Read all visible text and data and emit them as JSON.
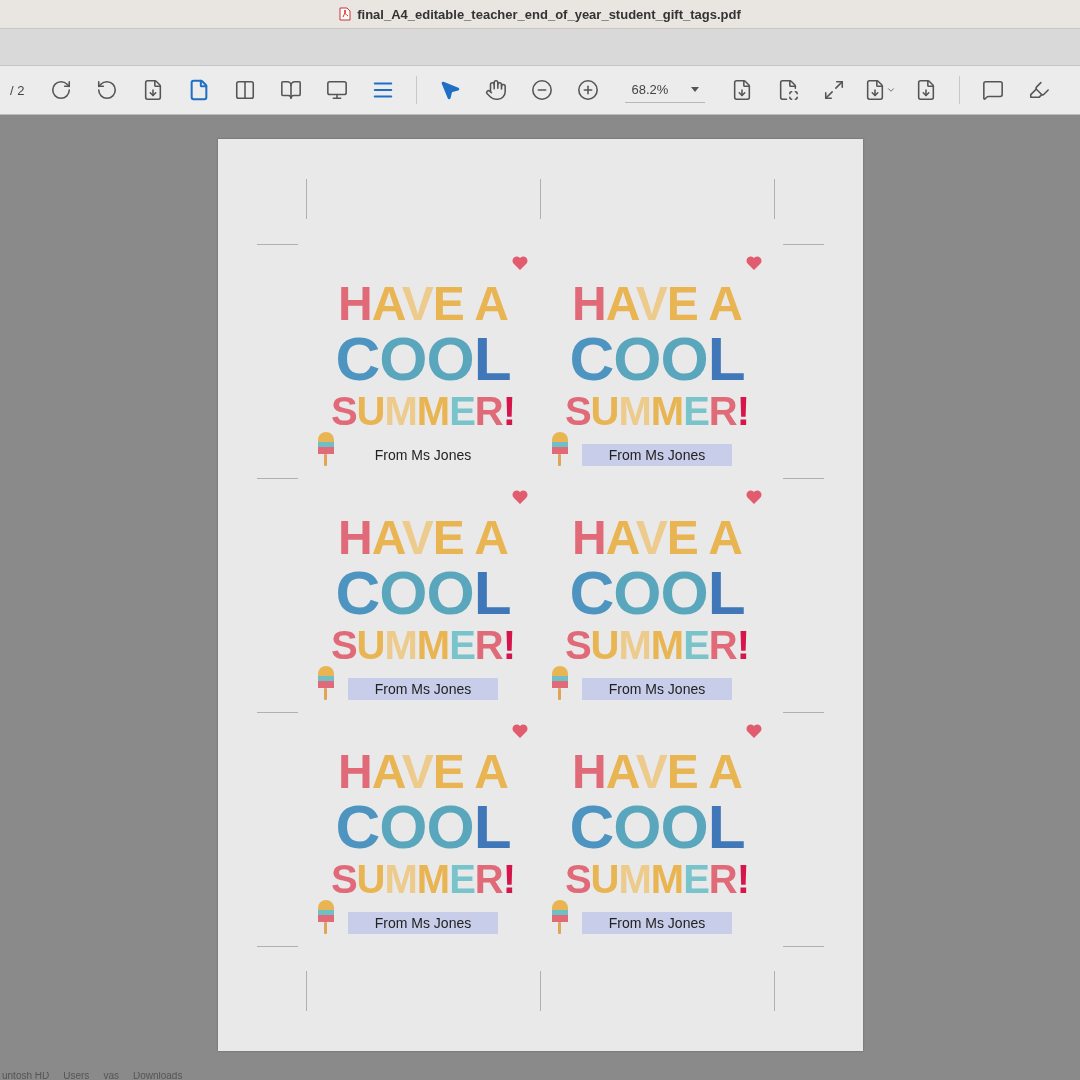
{
  "window": {
    "title": "final_A4_editable_teacher_end_of_year_student_gift_tags.pdf"
  },
  "toolbar": {
    "page_total": "/ 2",
    "zoom": "68.2%",
    "tools": [
      {
        "kind": "rotate-cw",
        "selected": false
      },
      {
        "kind": "rotate-ccw",
        "selected": false
      },
      {
        "kind": "fit-page",
        "selected": false
      },
      {
        "kind": "single-page",
        "selected": true
      },
      {
        "kind": "two-page",
        "selected": false
      },
      {
        "kind": "book",
        "selected": false
      },
      {
        "kind": "monitor",
        "selected": false
      },
      {
        "kind": "scroll",
        "selected": true
      },
      {
        "kind": "divider"
      },
      {
        "kind": "pointer",
        "selected": true
      },
      {
        "kind": "hand",
        "selected": false
      },
      {
        "kind": "zoom-out",
        "selected": false
      },
      {
        "kind": "zoom-in",
        "selected": false
      },
      {
        "kind": "zoom"
      },
      {
        "kind": "fit-width",
        "selected": false
      },
      {
        "kind": "fit-move",
        "selected": false
      },
      {
        "kind": "expand",
        "selected": false
      },
      {
        "kind": "fit-menu",
        "selected": false
      },
      {
        "kind": "stamp-down",
        "selected": false
      },
      {
        "kind": "divider"
      },
      {
        "kind": "comment",
        "selected": false
      },
      {
        "kind": "highlight",
        "selected": false
      }
    ]
  },
  "tags": [
    {
      "headline": [
        "HAVE A",
        "COOL",
        "SUMMER!"
      ],
      "field": {
        "value": "From Ms Jones",
        "focused": true
      }
    },
    {
      "headline": [
        "HAVE A",
        "COOL",
        "SUMMER!"
      ],
      "field": {
        "value": "From Ms Jones",
        "focused": false
      }
    },
    {
      "headline": [
        "HAVE A",
        "COOL",
        "SUMMER!"
      ],
      "field": {
        "value": "From Ms Jones",
        "focused": false
      }
    },
    {
      "headline": [
        "HAVE A",
        "COOL",
        "SUMMER!"
      ],
      "field": {
        "value": "From Ms Jones",
        "focused": false
      }
    },
    {
      "headline": [
        "HAVE A",
        "COOL",
        "SUMMER!"
      ],
      "field": {
        "value": "From Ms Jones",
        "focused": false
      }
    },
    {
      "headline": [
        "HAVE A",
        "COOL",
        "SUMMER!"
      ],
      "field": {
        "value": "From Ms Jones",
        "focused": false
      }
    }
  ],
  "path_bar": [
    "untosh HD",
    "Users",
    "vas",
    "Downloads"
  ]
}
